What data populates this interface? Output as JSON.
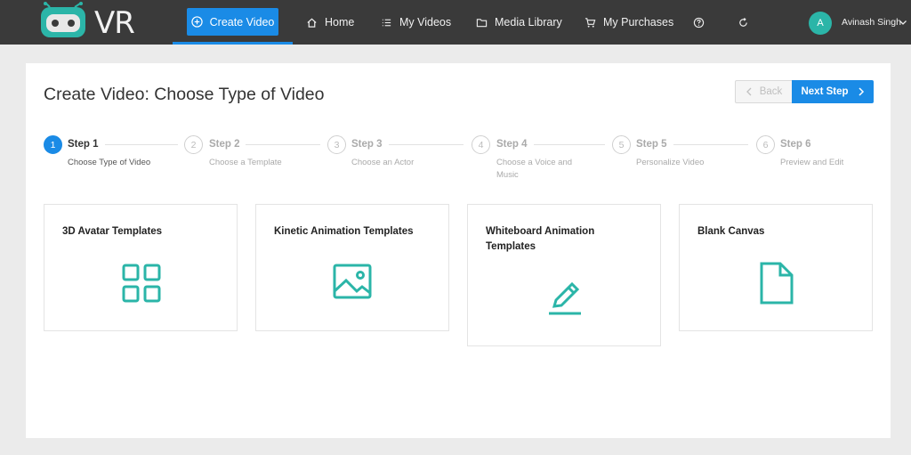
{
  "nav": {
    "logo_text": "VR",
    "create_video": "Create Video",
    "home": "Home",
    "my_videos": "My Videos",
    "media_library": "Media Library",
    "my_purchases": "My Purchases",
    "user_initial": "A",
    "user_name": "Avinash Singh"
  },
  "page": {
    "title": "Create Video: Choose Type of Video",
    "back": "Back",
    "next_step": "Next Step"
  },
  "steps": [
    {
      "num": "1",
      "title": "Step 1",
      "desc": "Choose Type of Video"
    },
    {
      "num": "2",
      "title": "Step 2",
      "desc": "Choose a Template"
    },
    {
      "num": "3",
      "title": "Step 3",
      "desc": "Choose an Actor"
    },
    {
      "num": "4",
      "title": "Step 4",
      "desc": "Choose a Voice and Music"
    },
    {
      "num": "5",
      "title": "Step 5",
      "desc": "Personalize Video"
    },
    {
      "num": "6",
      "title": "Step 6",
      "desc": "Preview and Edit"
    }
  ],
  "cards": [
    {
      "title": "3D Avatar Templates",
      "icon": "grid-icon"
    },
    {
      "title": "Kinetic Animation Templates",
      "icon": "image-icon"
    },
    {
      "title": "Whiteboard Animation Templates",
      "icon": "pencil-icon"
    },
    {
      "title": "Blank Canvas",
      "icon": "file-icon"
    }
  ],
  "colors": {
    "accent": "#1a8be6",
    "teal": "#2bb5a8",
    "topbar": "#3a3a3a"
  }
}
